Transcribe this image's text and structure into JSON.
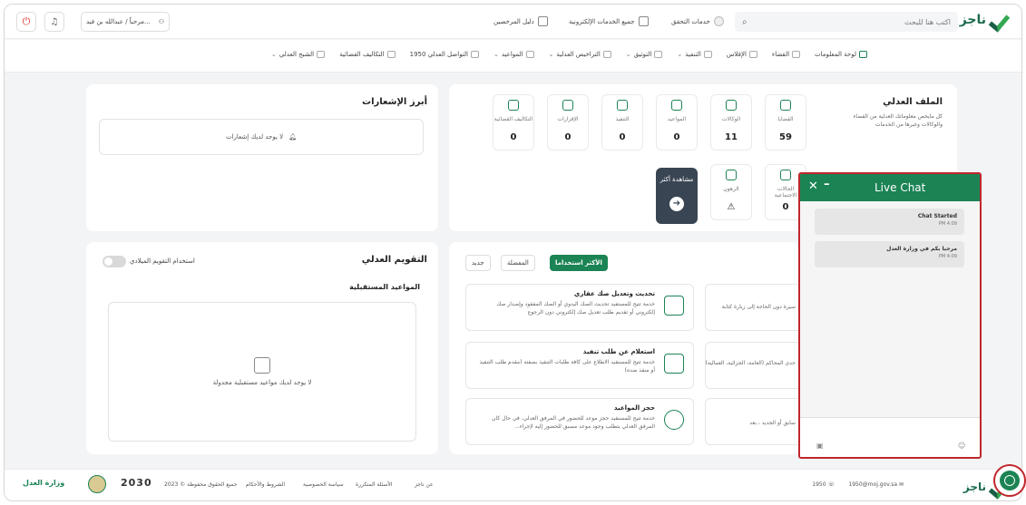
{
  "header": {
    "logo_text": "ناجز",
    "search_placeholder": "اكتب هنا للبحث",
    "links": [
      "خدمات التحقق",
      "جميع الخدمات الإلكترونية",
      "دليل المرخصين"
    ],
    "greeting": "مرحباً / عبدالله بن فيد...",
    "logout_icon": "logout-icon",
    "bell_icon": "bell-icon"
  },
  "nav": [
    {
      "label": "لوحة المعلومات",
      "chevron": false
    },
    {
      "label": "القضاء",
      "chevron": false
    },
    {
      "label": "الإفلاس",
      "chevron": false
    },
    {
      "label": "التنفيذ",
      "chevron": true
    },
    {
      "label": "التوثيق",
      "chevron": true
    },
    {
      "label": "التراخيص العدلية",
      "chevron": true
    },
    {
      "label": "المواعيد",
      "chevron": true
    },
    {
      "label": "التواصل العدلي 1950",
      "chevron": false
    },
    {
      "label": "التكاليف القضائية",
      "chevron": false
    },
    {
      "label": "الشبح العدلي",
      "chevron": true
    }
  ],
  "justice_file": {
    "title": "الملف العدلي",
    "subtitle": "كل مايخص معلوماتك العدلية من القضاء والوكالات وغيرها من الخدمات",
    "stats": [
      {
        "label": "القضايا",
        "value": "59"
      },
      {
        "label": "الوكالات",
        "value": "11"
      },
      {
        "label": "المواعيد",
        "value": "0"
      },
      {
        "label": "التنفيذ",
        "value": "0"
      },
      {
        "label": "الإقرارات",
        "value": "0"
      },
      {
        "label": "التكاليف القضائية",
        "value": "0"
      }
    ],
    "stats_row2": [
      {
        "label": "الحالات الاجتماعية",
        "value": "0"
      },
      {
        "label": "الرهون",
        "value": "⚠"
      }
    ],
    "more_label": "مشاهدة أكثر"
  },
  "notifications": {
    "title": "أبرز الإشعارات",
    "empty_text": "لا يوجد لديك إشعارات"
  },
  "services": {
    "tabs": [
      "الأكثر استخداما",
      "المفضلة",
      "جديد"
    ],
    "items": [
      {
        "title": "تحديث وتعديل صك عقاري",
        "desc": "خدمة تتيح للمستفيد تحديث الصك اليدوي أو الصك المفقود وإصدار صك إلكتروني أو تقديم طلب تعديل صك إلكتروني دون الرجوع"
      },
      {
        "title": "استعلام عن طلب تنفيذ",
        "desc": "خدمة تتيح للمستفيد الاطلاع على كافة طلبات التنفيذ بصفته (مقدم طلب التنفيذ أو منفذ ضده)"
      },
      {
        "title": "حجز المواعيد",
        "desc": "خدمة تتيح للمستفيد حجز موعد للحضور في المرفق العدلي، في حال كان المرفق العدلي يتطلب وجود موعد مسبق للحضور إليه لإجراء..."
      }
    ],
    "partial_right": [
      "سيرة دون الحاجة إلى زيارة كتابة",
      "حدى المحاكم (العامة، الجزائية، العمالية)",
      "سابق أو الجديد ، بعد"
    ]
  },
  "calendar": {
    "title": "التقويم العدلي",
    "toggle_label": "استخدام التقويم الميلادي",
    "upcoming_title": "المواعيد المستقبلية",
    "empty_text": "لا يوجد لديك مواعيد مستقبلية مجدولة"
  },
  "chat": {
    "title": "Live Chat",
    "messages": [
      {
        "text": "Chat Started",
        "time": "PM 4:09"
      },
      {
        "text": "مرحبا بكم في وزارة العدل",
        "time": "PM 4:09"
      }
    ]
  },
  "footer": {
    "links": [
      "عن ناجز",
      "الأسئلة المتكررة",
      "سياسة الخصوصية",
      "الشروط والأحكام"
    ],
    "copyright": "جميع الحقوق محفوظة © 2023",
    "vision": "2030",
    "ministry": "وزارة العدل",
    "email": "1950@moj.gov.sa",
    "phone": "1950",
    "logo_text": "ناجز"
  }
}
